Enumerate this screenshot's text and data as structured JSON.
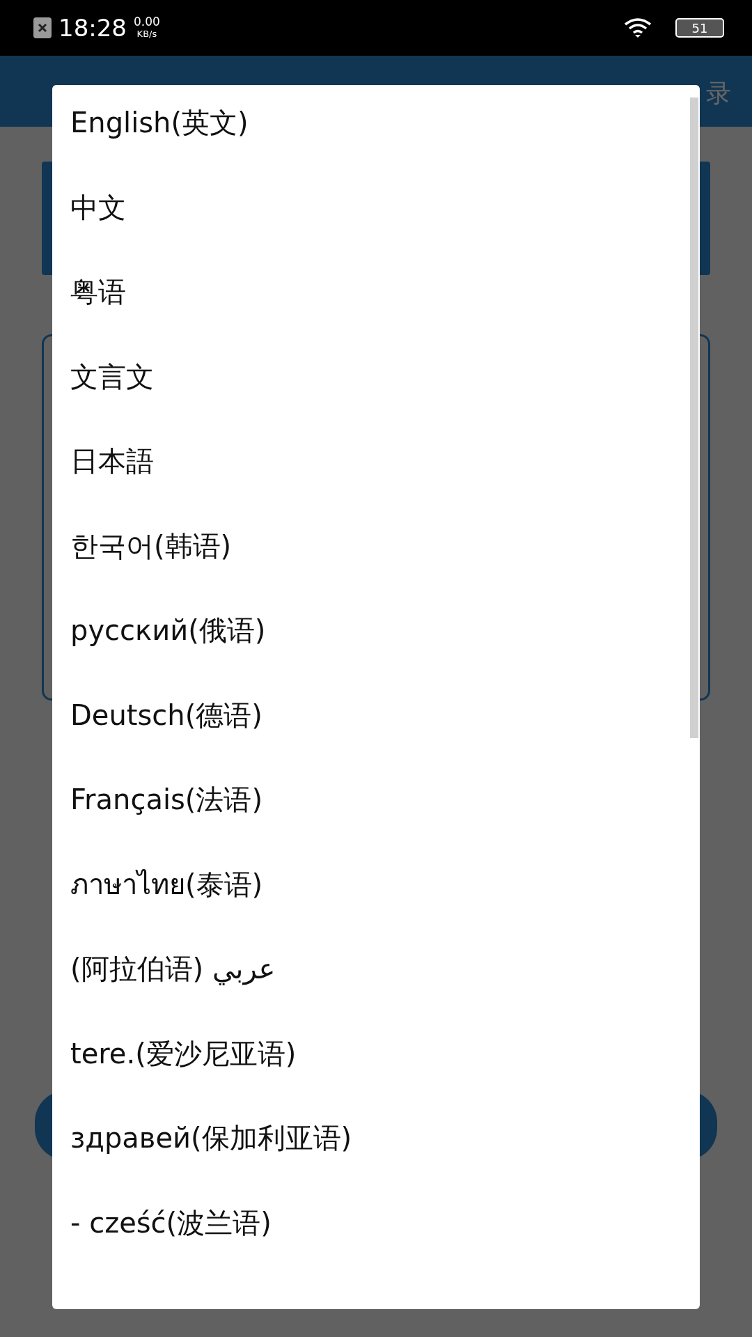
{
  "status_bar": {
    "time": "18:28",
    "speed_value": "0.00",
    "speed_unit": "KB/s",
    "battery": "51"
  },
  "header": {
    "action": "录"
  },
  "language_menu": {
    "items": [
      "English(英文)",
      "中文",
      "粤语",
      "文言文",
      "日本語",
      "한국어(韩语)",
      "русский(俄语)",
      "Deutsch(德语)",
      "Français(法语)",
      "ภาษาไทย(泰语)",
      "(阿拉伯语)  عربي",
      "tere.(爱沙尼亚语)",
      "здравей(保加利亚语)",
      "- cześć(波兰语)"
    ]
  }
}
